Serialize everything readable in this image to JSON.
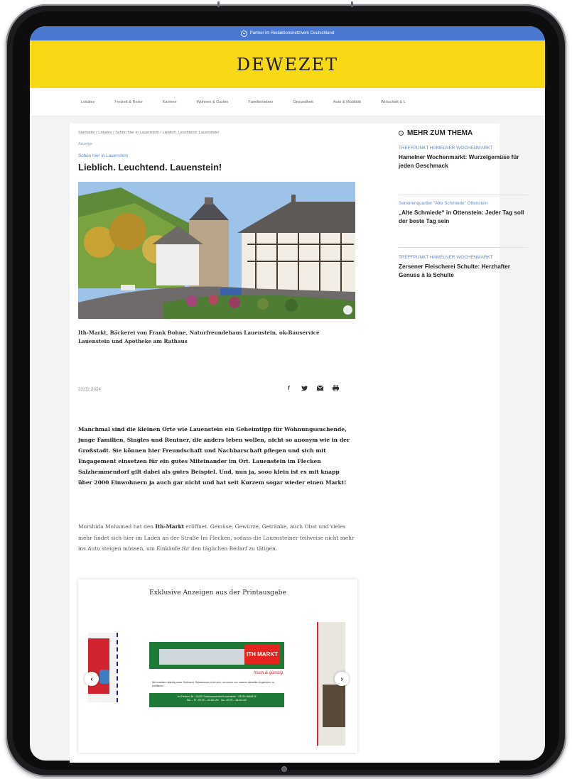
{
  "topbar": {
    "text": "Partner im Redaktionsnetzwerk Deutschland"
  },
  "masthead": {
    "logo": "DEWEZET"
  },
  "nav": {
    "items": [
      "Lokales",
      "Freizeit & Reise",
      "Karriere",
      "Wohnen & Garten",
      "Familienleben",
      "Gesundheit",
      "Auto & Mobilität",
      "Wirtschaft & L"
    ]
  },
  "article": {
    "breadcrumb": "Startseite / Lokales / Schön hier in Lauenstein / Lieblich. Leuchtend. Lauenstein!",
    "ad_label": "Anzeige",
    "kicker": "Schön hier in Lauenstein",
    "headline": "Lieblich. Leuchtend. Lauenstein!",
    "caption": "Ith-Markt, Bäckerei von Frank Bohne, Naturfreundehaus Lauenstein, ok-Bauservice Lauenstein und Apotheke am Rathaus",
    "date": "23.02.2024",
    "share": {
      "facebook": "f",
      "twitter": "♥",
      "mail": "✉",
      "print": "⎙"
    },
    "lead": "Manchmal sind die kleinen Orte wie Lauenstein ein Geheimtipp für Wohnungssuchende, junge Familien, Singles und Rentner, die anders leben wollen, nicht so anonym wie in der Großstadt. Sie können hier Freundschaft und Nachbarschaft pflegen und sich mit Engagement einsetzen für ein gutes Miteinander im Ort. Lauenstein im Flecken Salzhemmendorf gilt dabei als gutes Beispiel. Und, nun ja, sooo klein ist es mit knapp über 2000 Einwohnern ja auch gar nicht und hat seit Kurzem sogar wieder einen Markt!",
    "para_prefix": "Morshida Mohamed hat den ",
    "para_bold": "Ith-Markt",
    "para_rest": " eröffnet. Gemüse, Gewürze, Getränke, auch Obst und vieles mehr findet sich hier im Laden an der Straße Im Flecken, sodass die Lauensteiner teilweise nicht mehr ins Auto steigen müssen, um Einkäufe für den täglichen Bedarf zu tätigen."
  },
  "ads": {
    "title": "Exklusive Anzeigen aus der Printausgabe",
    "ith_logo": "ITH MARKT",
    "ith_tag": "frisch & günstig",
    "ith_small": "Wir erweitern ständig unser Sortiment. Reinschauen lohnt sich, um immer von unseren aktuellen Angeboten zu profitieren.",
    "ith_footer_1": "Im Flecken 36 · 31020 Salzhemmendorf/Lauenstein · 05153 9689979",
    "ith_footer_2": "Mo. – Fr.: 09.00 – 20.00 Uhr · Sa.: 09.00 – 18.00 Uhr",
    "prev": "‹",
    "next": "›"
  },
  "sidebar": {
    "heading": "MEHR ZUM THEMA",
    "items": [
      {
        "kicker": "TREFFPUNKT HAMELNER WOCHENMARKT",
        "title": "Hamelner Wochenmarkt: Wurzelgemüse für jeden Geschmack"
      },
      {
        "kicker": "Seniorenquartier \"Alte Schmiede\" Ottenstein",
        "title": "„Alte Schmiede“ in Ottenstein: Jeder Tag soll der beste Tag sein"
      },
      {
        "kicker": "TREFFPUNKT HAMELNER WOCHENMARKT",
        "title": "Zersener Fleischerei Schulte: Herzhafter Genuss à la Schulte"
      }
    ]
  },
  "colors": {
    "brand_yellow": "#f7d915",
    "top_blue": "#4a78d1",
    "link_blue": "#5f8dc9"
  }
}
